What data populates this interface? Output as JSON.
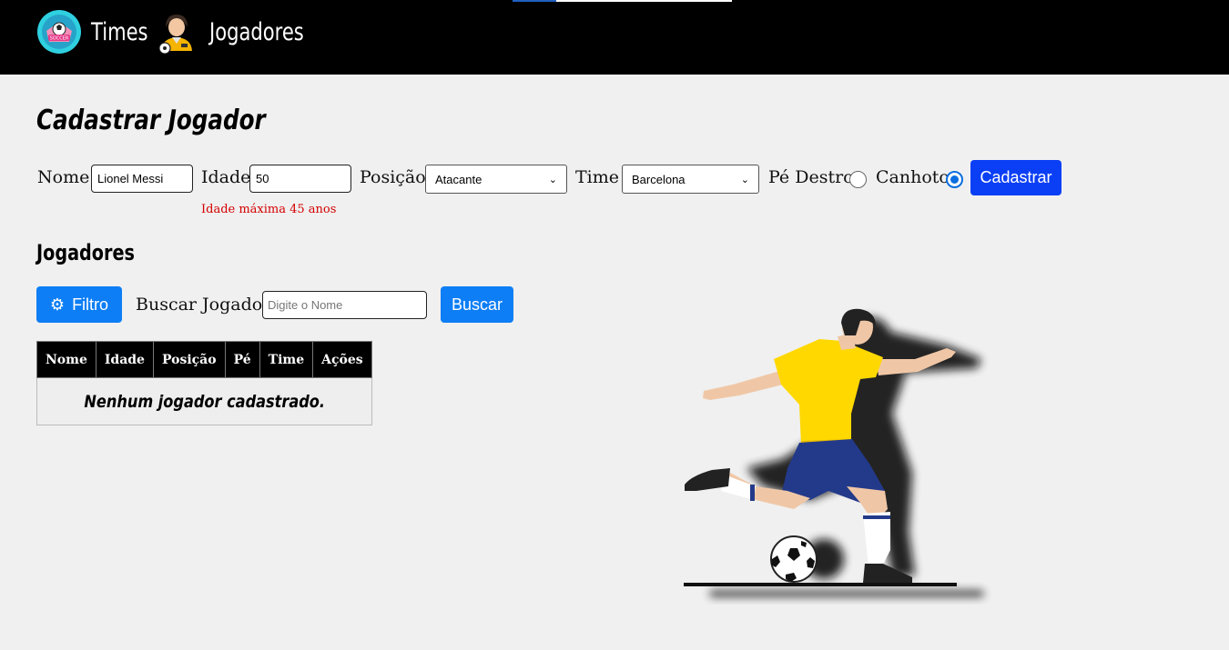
{
  "header": {
    "loading_progress": 0.2,
    "nav": [
      {
        "label": "Times",
        "icon": "soccer-badge-icon"
      },
      {
        "label": "Jogadores",
        "icon": "player-icon"
      }
    ]
  },
  "form": {
    "title": "Cadastrar Jogador",
    "nome_label": "Nome",
    "nome_value": "Lionel Messi",
    "idade_label": "Idade",
    "idade_value": "50",
    "posicao_label": "Posição",
    "posicao_value": "Atacante",
    "time_label": "Time",
    "time_value": "Barcelona",
    "pe_destro_label": "Pé Destro",
    "canhoto_label": "Canhoto",
    "selected_foot": "Canhoto",
    "submit_label": "Cadastrar",
    "error_message": "Idade máxima 45 anos"
  },
  "players": {
    "title": "Jogadores",
    "filter_label": "Filtro",
    "filter_icon": "gear-icon",
    "search_label": "Buscar Jogador",
    "search_placeholder": "Digite o Nome",
    "search_button": "Buscar",
    "columns": [
      "Nome",
      "Idade",
      "Posição",
      "Pé",
      "Time",
      "Ações"
    ],
    "empty_message": "Nenhum jogador cadastrado."
  },
  "colors": {
    "header_bg": "#000000",
    "primary_button": "#0d7ef5",
    "submit_button": "#0b3ff5",
    "error_text": "#d40000",
    "radio_selected": "#0a6ee0"
  }
}
